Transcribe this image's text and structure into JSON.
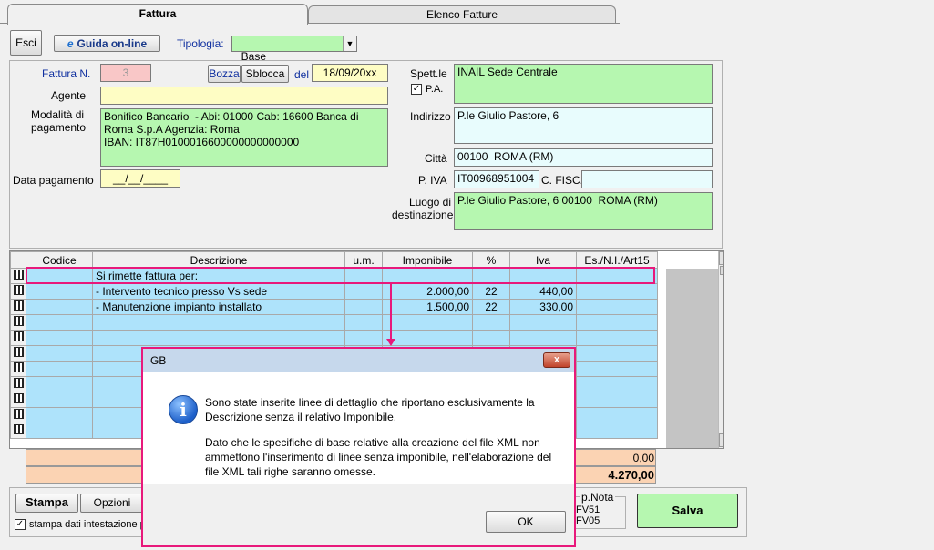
{
  "tabs": [
    {
      "label": "Fattura",
      "active": true
    },
    {
      "label": "Elenco Fatture",
      "active": false
    }
  ],
  "toolbar": {
    "exit_label": "Esci",
    "guide_label": "Guida on-line",
    "tipologia_label": "Tipologia:",
    "tipologia_value": "Base"
  },
  "invoice": {
    "numero_label": "Fattura N.",
    "numero_value": "3",
    "bozza_label": "Bozza",
    "sblocca_label": "Sblocca",
    "del_label": "del",
    "date_value": "18/09/20xx",
    "agente_label": "Agente",
    "agente_value": "",
    "modalita_label": "Modalità di pagamento",
    "modalita_value": "Bonifico Bancario  - Abi: 01000 Cab: 16600 Banca di Roma S.p.A Agenzia: Roma\nIBAN: IT87H0100016600000000000000",
    "data_pagamento_label": "Data pagamento",
    "data_pagamento_value": "__/__/____"
  },
  "client": {
    "spett_label": "Spett.le",
    "spett_value": "INAIL Sede Centrale",
    "pa_label": "P.A.",
    "pa_checked": true,
    "indirizzo_label": "Indirizzo",
    "indirizzo_value": "P.le Giulio Pastore, 6",
    "citta_label": "Città",
    "citta_value": "00100  ROMA (RM)",
    "piva_label": "P. IVA",
    "piva_value": "IT00968951004",
    "cfisc_label": "C. FISC.",
    "cfisc_value": "",
    "luogo_label": "Luogo di destinazione",
    "luogo_value": "P.le Giulio Pastore, 6 00100  ROMA (RM)"
  },
  "grid": {
    "columns": [
      "Codice",
      "Descrizione",
      "u.m.",
      "Imponibile",
      "%",
      "Iva",
      "Es./N.I./Art15"
    ],
    "rows": [
      [
        "",
        "Si rimette fattura per:",
        "",
        "",
        "",
        "",
        ""
      ],
      [
        "",
        "- Intervento tecnico presso Vs sede",
        "",
        "2.000,00",
        "22",
        "440,00",
        ""
      ],
      [
        "",
        "- Manutenzione impianto installato",
        "",
        "1.500,00",
        "22",
        "330,00",
        ""
      ],
      [
        "",
        "",
        "",
        "",
        "",
        "",
        ""
      ],
      [
        "",
        "",
        "",
        "",
        "",
        "",
        ""
      ],
      [
        "",
        "",
        "",
        "",
        "",
        "",
        ""
      ],
      [
        "",
        "",
        "",
        "",
        "",
        "",
        ""
      ],
      [
        "",
        "",
        "",
        "",
        "",
        "",
        ""
      ],
      [
        "",
        "",
        "",
        "",
        "",
        "",
        ""
      ],
      [
        "",
        "",
        "",
        "",
        "",
        "",
        ""
      ],
      [
        "",
        "",
        "",
        "",
        "",
        "",
        ""
      ]
    ]
  },
  "totals": {
    "value1": "0,00",
    "value2": "4.270,00"
  },
  "bottom": {
    "stampa_tab": "Stampa",
    "opzioni_tab": "Opzioni",
    "stampa_check_label": "stampa dati intestazione p",
    "stampa_checked": true,
    "pnota_label": "p.Nota",
    "pnota_line1": "FV51",
    "pnota_line2": "FV05",
    "salva_label": "Salva"
  },
  "dialog": {
    "title": "GB",
    "close_label": "x",
    "icon": "info-icon",
    "paragraph1": "Sono state inserite linee di dettaglio che riportano esclusivamente la Descrizione senza il relativo Imponibile.",
    "paragraph2": "Dato che le specifiche di base relative alla creazione del file XML non ammettono l'inserimento di linee senza imponibile, nell'elaborazione del file XML tali righe saranno omesse.",
    "ok_label": "OK"
  },
  "colors": {
    "highlight": "#e8197b",
    "green_field": "#b6f7b0",
    "row_cyan": "#aee3fb"
  }
}
